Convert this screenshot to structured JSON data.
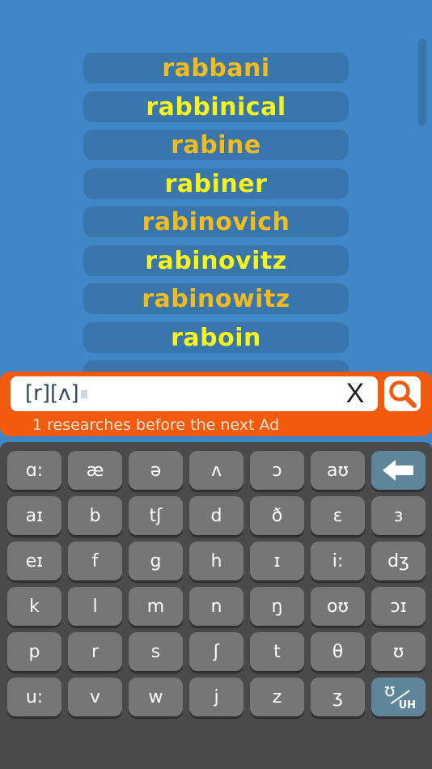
{
  "word_list": {
    "items": [
      {
        "label": "rabbani",
        "color": "#f3bb1b"
      },
      {
        "label": "rabbinical",
        "color": "#f6f21e"
      },
      {
        "label": "rabine",
        "color": "#f3bb1b"
      },
      {
        "label": "rabiner",
        "color": "#f6f21e"
      },
      {
        "label": "rabinovich",
        "color": "#f3bb1b"
      },
      {
        "label": "rabinovitz",
        "color": "#f6f21e"
      },
      {
        "label": "rabinowitz",
        "color": "#f3bb1b"
      },
      {
        "label": "raboin",
        "color": "#f6f21e"
      },
      {
        "label": "",
        "color": "#f3bb1b"
      }
    ]
  },
  "search": {
    "value": "[r][ʌ]",
    "clear_label": "X",
    "search_icon": "magnifier-icon",
    "ad_counter": "1 researches before the next Ad"
  },
  "keyboard": {
    "rows": [
      [
        "ɑ:",
        "æ",
        "ə",
        "ʌ",
        "ɔ",
        "aʊ",
        "backspace"
      ],
      [
        "aɪ",
        "b",
        "tʃ",
        "d",
        "ð",
        "ɛ",
        "з"
      ],
      [
        "eɪ",
        "f",
        "g",
        "h",
        "ɪ",
        "i:",
        "dʒ"
      ],
      [
        "k",
        "l",
        "m",
        "n",
        "ŋ",
        "oʊ",
        "ɔɪ"
      ],
      [
        "p",
        "r",
        "s",
        "ʃ",
        "t",
        "θ",
        "ʊ"
      ],
      [
        "u:",
        "v",
        "w",
        "j",
        "z",
        "ʒ",
        "ʊ/UH"
      ]
    ],
    "uh_key": {
      "symbol": "ʊ",
      "label": "UH"
    },
    "colors": {
      "key": "#767676",
      "special_key": "#5f8599",
      "background": "#4a4a4a"
    }
  },
  "colors": {
    "background": "#3f87c6",
    "pill": "#3876ad",
    "accent": "#f25b0f",
    "word_orange": "#f3bb1b",
    "word_yellow": "#f6f21e"
  }
}
